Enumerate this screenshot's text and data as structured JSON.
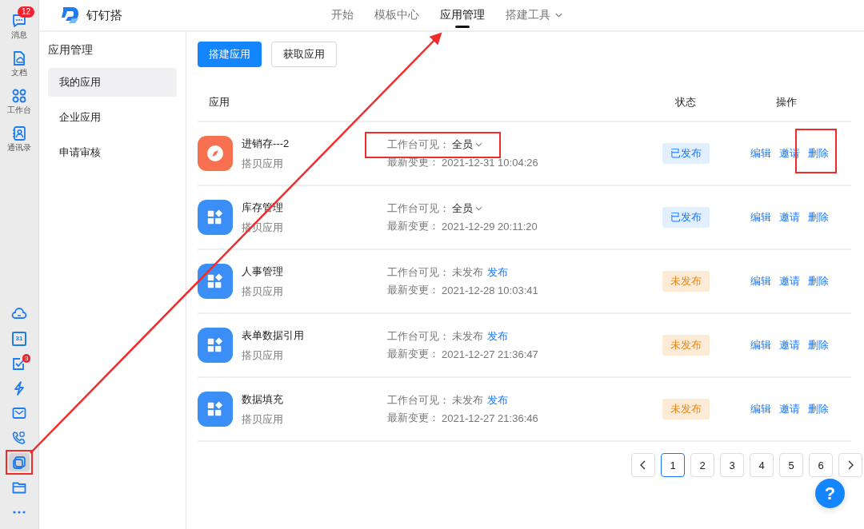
{
  "rail": {
    "top": [
      {
        "kind": "chat",
        "label": "消息",
        "badge": "12"
      },
      {
        "kind": "doc",
        "label": "文档"
      },
      {
        "kind": "apps",
        "label": "工作台"
      },
      {
        "kind": "contacts",
        "label": "通讯录"
      }
    ],
    "bottom": [
      {
        "kind": "cloud",
        "selected": false,
        "highlighted": false
      },
      {
        "kind": "calendar",
        "text": "31",
        "selected": false,
        "highlighted": false
      },
      {
        "kind": "todo",
        "badge": "3",
        "selected": false,
        "highlighted": false
      },
      {
        "kind": "bolt",
        "selected": false,
        "highlighted": false
      },
      {
        "kind": "mail",
        "selected": false,
        "highlighted": false
      },
      {
        "kind": "phone",
        "selected": false,
        "highlighted": false
      },
      {
        "kind": "builder",
        "selected": true,
        "highlighted": true
      },
      {
        "kind": "folder",
        "selected": false,
        "highlighted": false
      },
      {
        "kind": "more",
        "selected": false,
        "highlighted": false
      }
    ]
  },
  "header": {
    "title": "钉钉搭",
    "nav": [
      {
        "label": "开始",
        "selected": false
      },
      {
        "label": "模板中心",
        "selected": false
      },
      {
        "label": "应用管理",
        "selected": true
      },
      {
        "label": "搭建工具",
        "selected": false,
        "dropdown": true
      }
    ]
  },
  "sidebar": {
    "title": "应用管理",
    "items": [
      {
        "label": "我的应用",
        "selected": true
      },
      {
        "label": "企业应用",
        "selected": false
      },
      {
        "label": "申请审核",
        "selected": false
      }
    ]
  },
  "toolbar": {
    "buttons": [
      {
        "label": "搭建应用",
        "kind": "primary"
      },
      {
        "label": "获取应用",
        "kind": "default"
      }
    ]
  },
  "table": {
    "columns": [
      "应用",
      "状态",
      "操作"
    ],
    "rows": [
      {
        "kind": "compass",
        "color": "#f7704f",
        "name": "进销存---2",
        "source": "搭贝应用",
        "visibility_label": "工作台可见：",
        "visibility": "全员",
        "visibility_dropdown": true,
        "visibility_highlighted": true,
        "changed_label": "最新变更：",
        "changed": "2021-12-31 10:04:26",
        "status": "已发布",
        "published": true,
        "actions": [
          {
            "label": "编辑",
            "highlighted": false
          },
          {
            "label": "邀请",
            "highlighted": false
          },
          {
            "label": "删除",
            "highlighted": true
          }
        ]
      },
      {
        "kind": "grid",
        "color": "#3a8ef6",
        "name": "库存管理",
        "source": "搭贝应用",
        "visibility_label": "工作台可见：",
        "visibility": "全员",
        "visibility_dropdown": true,
        "visibility_highlighted": false,
        "changed_label": "最新变更：",
        "changed": "2021-12-29 20:11:20",
        "status": "已发布",
        "published": true,
        "actions": [
          {
            "label": "编辑",
            "highlighted": false
          },
          {
            "label": "邀请",
            "highlighted": false
          },
          {
            "label": "删除",
            "highlighted": false
          }
        ]
      },
      {
        "kind": "grid",
        "color": "#3a8ef6",
        "name": "人事管理",
        "source": "搭贝应用",
        "visibility_label": "工作台可见：",
        "visibility": "未发布",
        "visibility_dropdown": false,
        "publish_link": "发布",
        "visibility_highlighted": false,
        "changed_label": "最新变更：",
        "changed": "2021-12-28 10:03:41",
        "status": "未发布",
        "published": false,
        "actions": [
          {
            "label": "编辑",
            "highlighted": false
          },
          {
            "label": "邀请",
            "highlighted": false
          },
          {
            "label": "删除",
            "highlighted": false
          }
        ]
      },
      {
        "kind": "grid",
        "color": "#3a8ef6",
        "name": "表单数据引用",
        "source": "搭贝应用",
        "visibility_label": "工作台可见：",
        "visibility": "未发布",
        "visibility_dropdown": false,
        "publish_link": "发布",
        "visibility_highlighted": false,
        "changed_label": "最新变更：",
        "changed": "2021-12-27 21:36:47",
        "status": "未发布",
        "published": false,
        "actions": [
          {
            "label": "编辑",
            "highlighted": false
          },
          {
            "label": "邀请",
            "highlighted": false
          },
          {
            "label": "删除",
            "highlighted": false
          }
        ]
      },
      {
        "kind": "grid",
        "color": "#3a8ef6",
        "name": "数据填充",
        "source": "搭贝应用",
        "visibility_label": "工作台可见：",
        "visibility": "未发布",
        "visibility_dropdown": false,
        "publish_link": "发布",
        "visibility_highlighted": false,
        "changed_label": "最新变更：",
        "changed": "2021-12-27 21:36:46",
        "status": "未发布",
        "published": false,
        "actions": [
          {
            "label": "编辑",
            "highlighted": false
          },
          {
            "label": "邀请",
            "highlighted": false
          },
          {
            "label": "删除",
            "highlighted": false
          }
        ]
      }
    ]
  },
  "pagination": {
    "pages": [
      {
        "label": "1",
        "selected": true
      },
      {
        "label": "2",
        "selected": false
      },
      {
        "label": "3",
        "selected": false
      },
      {
        "label": "4",
        "selected": false
      },
      {
        "label": "5",
        "selected": false
      },
      {
        "label": "6",
        "selected": false
      }
    ]
  },
  "help": {
    "label": "?"
  }
}
